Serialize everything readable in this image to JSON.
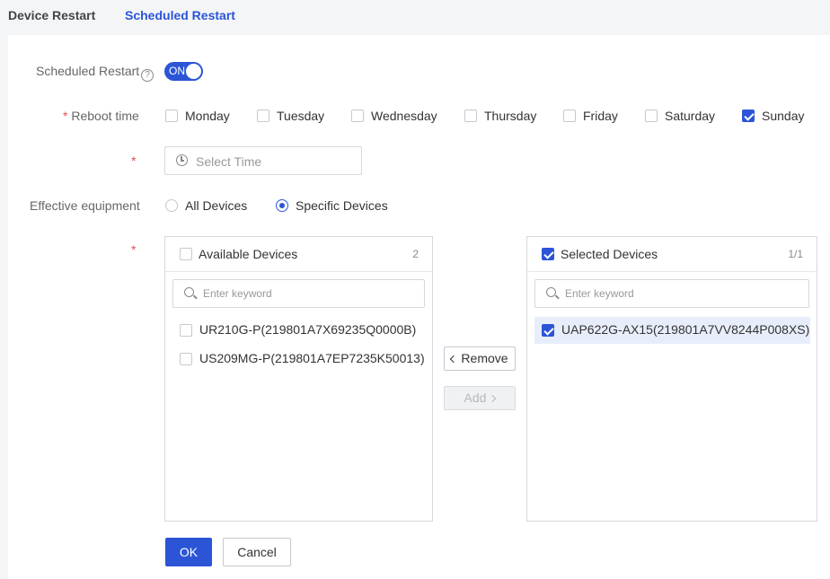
{
  "tabs": [
    {
      "label": "Device Restart",
      "active": false
    },
    {
      "label": "Scheduled Restart",
      "active": true
    }
  ],
  "form": {
    "scheduled_restart": {
      "label": "Scheduled Restart",
      "toggle_text": "ON",
      "enabled": true
    },
    "reboot_time": {
      "required_mark": "*",
      "label": "Reboot time",
      "days": [
        {
          "label": "Monday",
          "checked": false
        },
        {
          "label": "Tuesday",
          "checked": false
        },
        {
          "label": "Wednesday",
          "checked": false
        },
        {
          "label": "Thursday",
          "checked": false
        },
        {
          "label": "Friday",
          "checked": false
        },
        {
          "label": "Saturday",
          "checked": false
        },
        {
          "label": "Sunday",
          "checked": true
        }
      ]
    },
    "time": {
      "required_mark": "*",
      "placeholder": "Select Time"
    },
    "effective_equipment": {
      "label": "Effective equipment",
      "options": [
        {
          "label": "All Devices",
          "selected": false
        },
        {
          "label": "Specific Devices",
          "selected": true
        }
      ]
    },
    "devices": {
      "required_mark": "*",
      "available": {
        "title": "Available Devices",
        "count": "2",
        "search_placeholder": "Enter keyword",
        "items": [
          {
            "label": "UR210G-P(219801A7X69235Q0000B)",
            "checked": false
          },
          {
            "label": "US209MG-P(219801A7EP7235K50013)",
            "checked": false
          }
        ]
      },
      "selected": {
        "title": "Selected Devices",
        "count": "1/1",
        "search_placeholder": "Enter keyword",
        "items": [
          {
            "label": "UAP622G-AX15(219801A7VV8244P008XS)",
            "checked": true
          }
        ]
      },
      "remove_label": "Remove",
      "add_label": "Add"
    }
  },
  "actions": {
    "ok": "OK",
    "cancel": "Cancel"
  },
  "colors": {
    "accent": "#2b55d6",
    "required": "#e34d4d"
  }
}
